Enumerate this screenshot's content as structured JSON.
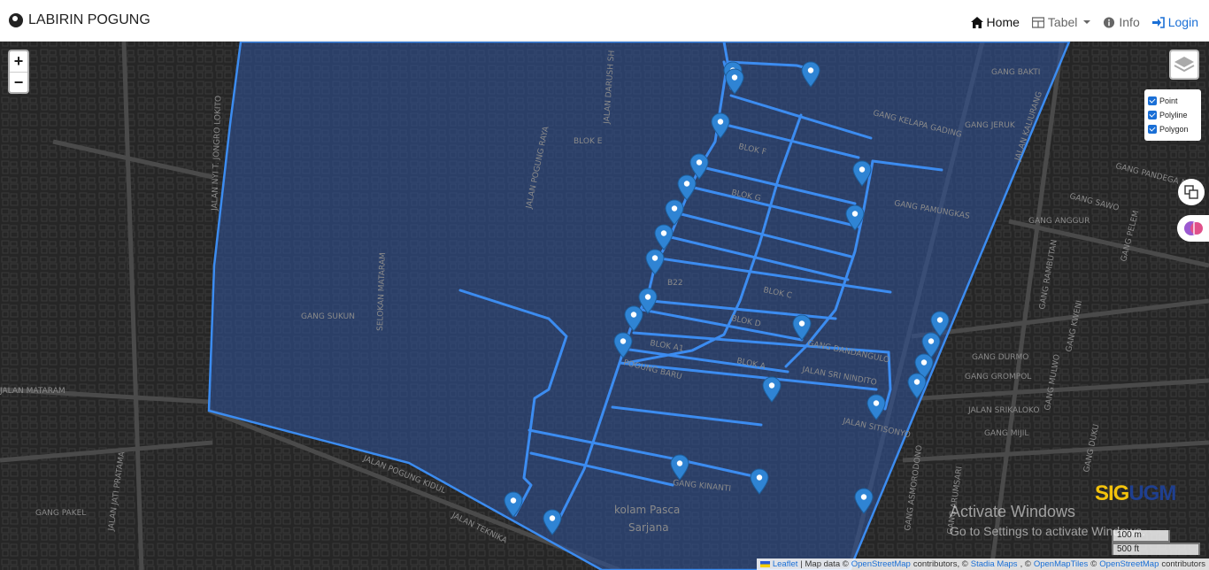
{
  "app": {
    "title": "LABIRIN POGUNG"
  },
  "nav": {
    "home": "Home",
    "tabel": "Tabel",
    "info": "Info",
    "login": "Login"
  },
  "map": {
    "zoom_in": "+",
    "zoom_out": "−",
    "layers": [
      "Point",
      "Polyline",
      "Polygon"
    ],
    "street_labels": {
      "jalan_nyi_t_jonggrolo": "JALAN NYI T. JONGRO LOKITO",
      "jalan_mataram": "JALAN MATARAM",
      "gang_sukun": "GANG SUKUN",
      "selokan_mataram": "SELOKAN MATARAM",
      "jalan_pogung_raya": "JALAN POGUNG RAYA",
      "jalan_darush": "JALAN DARUSH SH",
      "blok_e": "BLOK E",
      "gang_kelapa_gading": "GANG KELAPA GADING",
      "gang_jeruk": "GANG JERUK",
      "gang_bakti": "GANG BAKTI",
      "gang_pamungkas": "GANG PAMUNGKAS",
      "jalan_kaliurang": "JALAN KALIURANG",
      "gang_pandega": "GANG PANDEGA MA",
      "gang_sawo": "GANG SAWO",
      "gang_anggur": "GANG ANGGUR",
      "b22": "B22",
      "blok_c": "BLOK C",
      "blok_d": "BLOK D",
      "blok_a1": "BLOK A1",
      "blok_a": "BLOK A",
      "pogung_baru": "POGUNG BARU",
      "gang_dandangulo": "GANG DANDANGULO",
      "jalan_sri_ninditto": "JALAN SRI NINDITO",
      "jalan_sitisonyo": "JALAN SITISONYO",
      "gang_durmo": "GANG DURMO",
      "gang_grompol": "GANG GROMPOL",
      "jalan_srikaloko": "JALAN SRIKALOKO",
      "gang_mijil": "GANG MIJIL",
      "gang_kinanti": "GANG KINANTI",
      "kolam_pasca": "kolam Pasca",
      "sarjana": "Sarjana",
      "jalan_pogung_kidul": "JALAN POGUNG KIDUL",
      "jalan_teknika": "JALAN TEKNIKA",
      "gang_pakel": "GANG PAKEL",
      "jalan_jati_pratama": "JALAN JATI PRATAMA",
      "gang_asmorodono": "GANG ASMORODONO",
      "gang_arumsari": "GANG ARUMSARI",
      "gang_duku": "GANG DUKU",
      "gang_kweni": "GANG KWENI",
      "gang_mulwo": "GANG MULWO",
      "gang_rambutan": "GANG RAMBUTAN",
      "gang_pelem": "GANG PELEM",
      "blok_f": "BLOK F",
      "blok_g": "BLOK G"
    },
    "logo": {
      "part1": "SIG",
      "part2": "UGM"
    },
    "watermark": {
      "line1": "Activate Windows",
      "line2": "Go to Settings to activate Windows."
    },
    "scale": {
      "metric": "100 m",
      "imperial": "500 ft"
    },
    "attribution": {
      "leaflet": "Leaflet",
      "sep1": "| Map data ©",
      "osm1": "OpenStreetMap",
      "mid1": "contributors, ©",
      "stadia": "Stadia Maps",
      "mid2": ", ©",
      "omt": "OpenMapTiles",
      "mid3": "©",
      "osm2": "OpenStreetMap",
      "end": "contributors"
    },
    "colors": {
      "polygon_fill": "#2e4f8f",
      "polyline": "#3c8cf0",
      "marker": "#2f84d4",
      "base": "#262626"
    }
  }
}
